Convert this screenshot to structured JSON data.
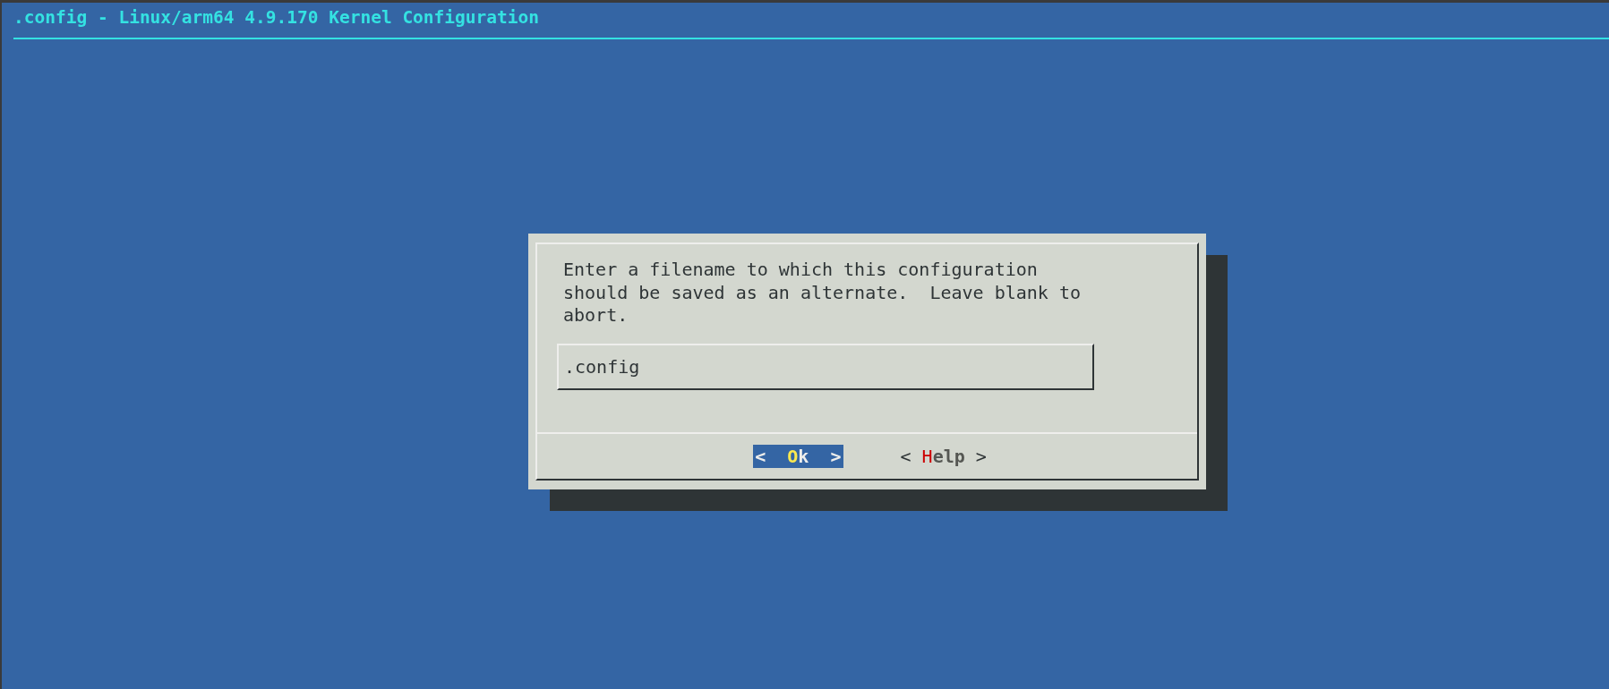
{
  "window": {
    "title": ".config - Linux/arm64 4.9.170 Kernel Configuration"
  },
  "dialog": {
    "message": "Enter a filename to which this configuration should be saved as an alternate.  Leave blank to abort.",
    "input": {
      "value": ".config"
    },
    "buttons": [
      {
        "open": "<",
        "hotkey": "O",
        "rest": "k",
        "close": ">",
        "selected": true
      },
      {
        "open": "<",
        "hotkey": "H",
        "rest": "elp",
        "close": ">",
        "selected": false
      }
    ]
  }
}
